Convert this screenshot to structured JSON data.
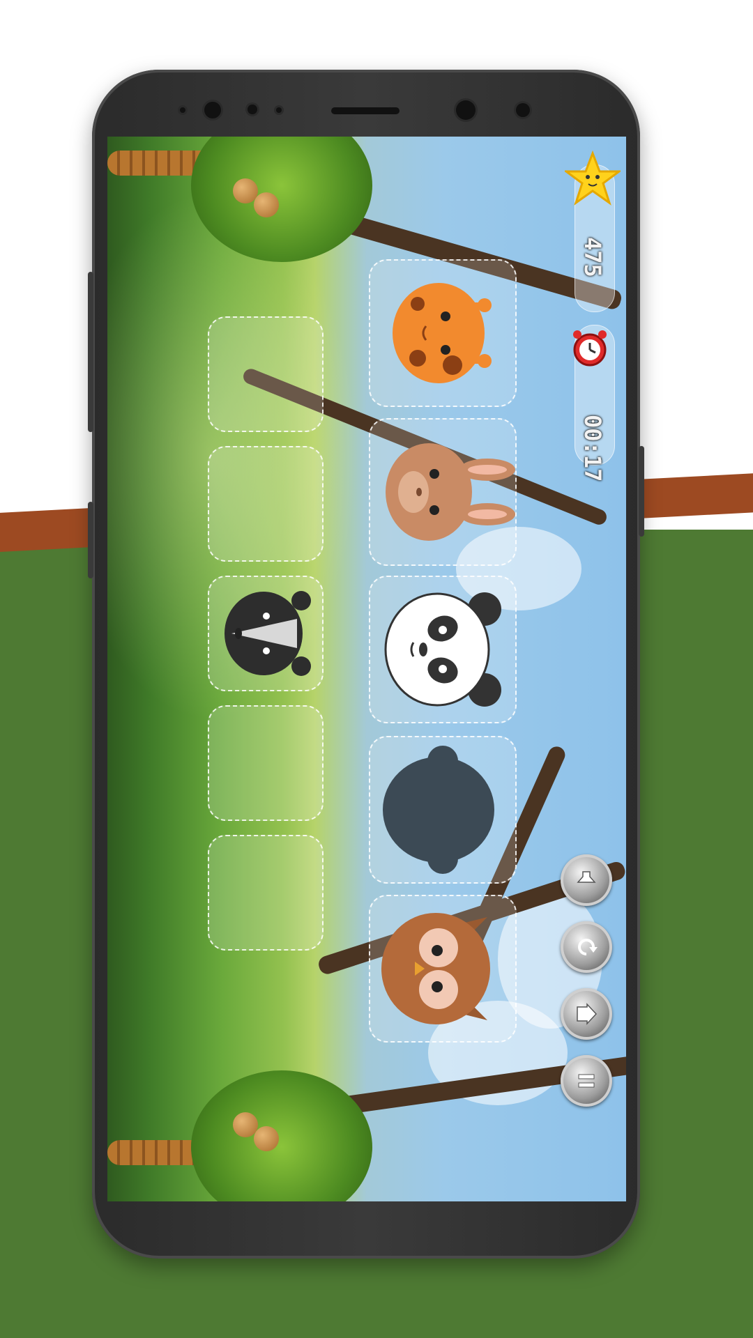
{
  "hud": {
    "score": "475",
    "timer": "00:17",
    "star_icon": "star-icon",
    "clock_icon": "alarm-clock-icon"
  },
  "animals_top_row": [
    "giraffe",
    "rabbit",
    "panda",
    "monkey-silhouette",
    "owl"
  ],
  "answer_slots": [
    "empty",
    "empty",
    "badger",
    "empty",
    "empty"
  ],
  "control_buttons": [
    "sound-icon",
    "restart-icon",
    "home-icon",
    "pause-icon"
  ],
  "colors": {
    "bg_green": "#4e7a33",
    "stripe": "#9d4a22",
    "phone_body": "#2b2b2b"
  }
}
